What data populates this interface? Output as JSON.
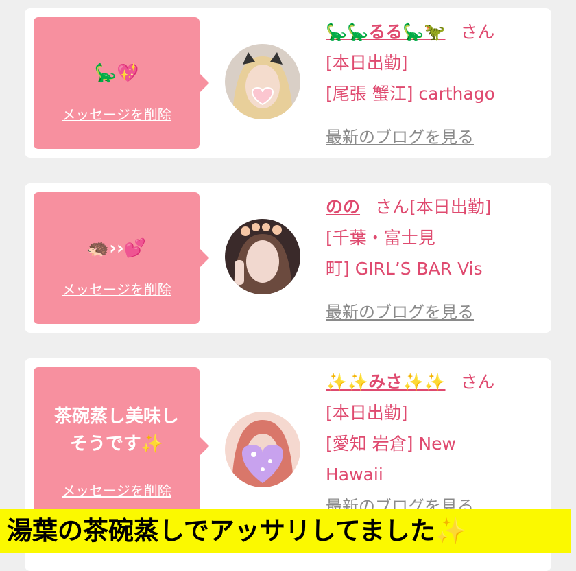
{
  "messages": [
    {
      "bubble_text": "🦕💖",
      "delete_label": "メッセージを削除",
      "name": "🦕🦕るる🦕🦖",
      "honorific": "さん",
      "status": "[本日出勤]",
      "shop_line1": "[尾張 蟹江] carthago",
      "shop_line2": "",
      "blog_label": "最新のブログを見る"
    },
    {
      "bubble_text": "🦔››💕",
      "delete_label": "メッセージを削除",
      "name": "のの",
      "honorific": "さん[本日出勤]",
      "status": "[千葉・富士見",
      "shop_line1": "町] GIRL’S BAR Vis",
      "shop_line2": "",
      "blog_label": "最新のブログを見る"
    },
    {
      "bubble_text": "茶碗蒸し美味しそうです✨",
      "delete_label": "メッセージを削除",
      "name": "✨✨みさ✨✨",
      "honorific": "さん",
      "status": "[本日出勤]",
      "shop_line1": "[愛知 岩倉] New",
      "shop_line2": "Hawaii",
      "blog_label": "最新のブログを見る"
    }
  ],
  "caption": "湯葉の茶碗蒸しでアッサリしてました✨"
}
